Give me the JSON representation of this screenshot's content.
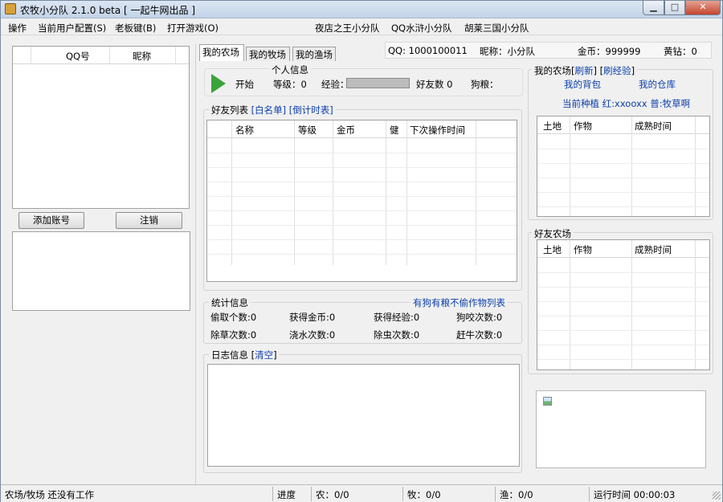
{
  "window": {
    "title": "农牧小分队 2.1.0 beta [ 一起牛网出品 ]",
    "min_label": "▁",
    "max_label": "□",
    "close_label": "✕"
  },
  "menu": {
    "items": [
      "操作",
      "当前用户配置(S)",
      "老板键(B)",
      "打开游戏(O)"
    ],
    "links": [
      "夜店之王小分队",
      "QQ水浒小分队",
      "胡莱三国小分队"
    ]
  },
  "accounts": {
    "columns": [
      "QQ号",
      "昵称"
    ],
    "add_label": "添加账号",
    "logout_label": "注销"
  },
  "tabs": [
    "我的农场",
    "我的牧场",
    "我的渔场"
  ],
  "info_bar": {
    "qq": "QQ:  1000100011",
    "nick": "昵称：小分队",
    "gold": "金币：999999",
    "diamond": "黄钻：0"
  },
  "start": {
    "label": "开始"
  },
  "personal": {
    "title": "个人信息",
    "level": "等级：0",
    "exp": "经验：",
    "friends": "好友数 0",
    "dog_food": "狗粮："
  },
  "friends": {
    "title": "好友列表",
    "whitelist": "[白名单]",
    "countdown": "[倒计时表]",
    "columns": [
      "名称",
      "等级",
      "金币",
      "健",
      "下次操作时间"
    ]
  },
  "stats": {
    "title": "统计信息",
    "link": "有狗有粮不偷作物列表",
    "items": [
      "偷取个数:0",
      "获得金币:0",
      "获得经验:0",
      "狗咬次数:0",
      "除草次数:0",
      "浇水次数:0",
      "除虫次数:0",
      "赶牛次数:0"
    ]
  },
  "log": {
    "title": "日志信息",
    "clear": "清空"
  },
  "my_farm": {
    "title": "我的农场",
    "refresh": "刷新",
    "brush": "刷经验",
    "bag": "我的背包",
    "warehouse": "我的仓库",
    "planting": "当前种植 红:xxooxx 普:牧草啊",
    "columns": [
      "土地",
      "作物",
      "成熟时间"
    ]
  },
  "friend_farm": {
    "title": "好友农场",
    "columns": [
      "土地",
      "作物",
      "成熟时间"
    ]
  },
  "status": {
    "work": "农场/牧场 还没有工作",
    "progress": "进度",
    "farm": "农：0/0",
    "pasture": "牧：0/0",
    "fishery": "渔：0/0",
    "runtime": "运行时间 00:00:03"
  }
}
